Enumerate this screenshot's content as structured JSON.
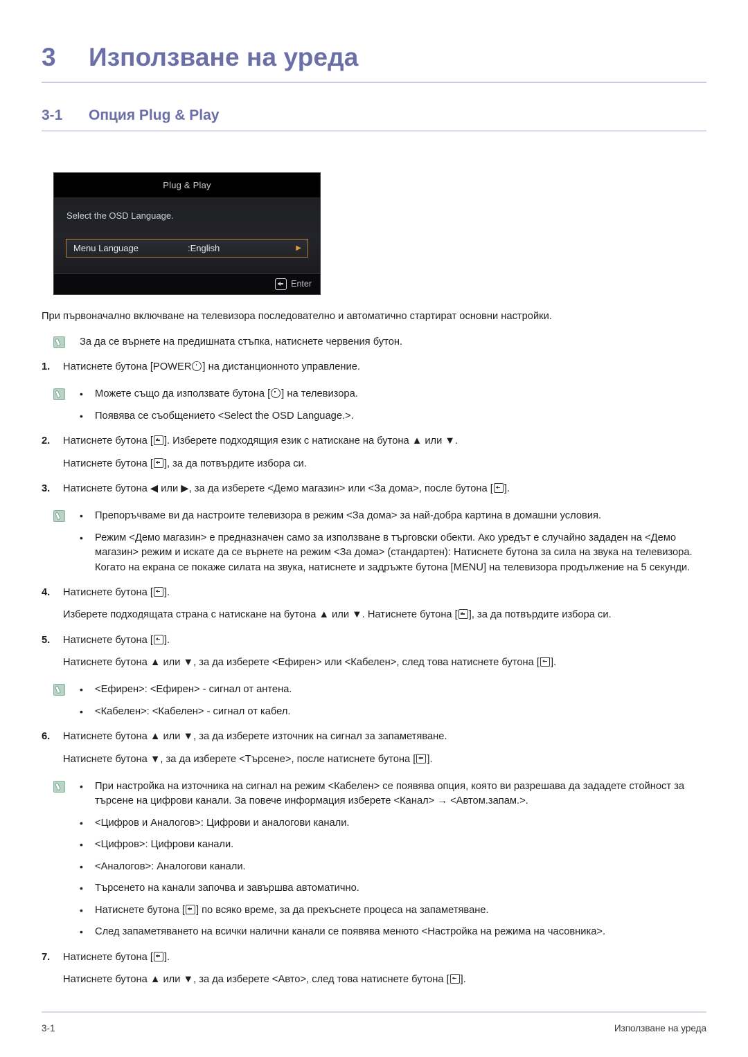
{
  "chapter": {
    "number": "3",
    "title": "Използване на уреда"
  },
  "section": {
    "number": "3-1",
    "title": "Опция Plug & Play"
  },
  "osd": {
    "title": "Plug & Play",
    "prompt": "Select the OSD Language.",
    "row_label": "Menu Language",
    "row_value": ":English",
    "row_arrow": "▶",
    "footer_label": "Enter"
  },
  "intro": "При първоначално включване на телевизора последователно и автоматично стартират основни настройки.",
  "note_intro": "За да се върнете на предишната стъпка, натиснете червения бутон.",
  "steps": [
    {
      "num": "1.",
      "lines": [
        {
          "pre": "Натиснете бутона [POWER",
          "glyph": "power",
          "post": "] на дистанционното управление."
        }
      ]
    },
    {
      "num": "2.",
      "lines": [
        {
          "pre": "Натиснете бутона [",
          "glyph": "enter",
          "post": "]. Изберете подходящия език с натискане на бутона ▲ или ▼."
        },
        {
          "pre": "Натиснете бутона [",
          "glyph": "enter",
          "post": "], за да потвърдите избора си."
        }
      ]
    },
    {
      "num": "3.",
      "lines": [
        {
          "pre": "Натиснете бутона ◀ или ▶, за да изберете <Демо магазин> или <За дома>, после бутона [",
          "glyph": "enter",
          "post": "]."
        }
      ]
    },
    {
      "num": "4.",
      "lines": [
        {
          "pre": "Натиснете бутона [",
          "glyph": "enter",
          "post": "]."
        },
        {
          "pre": "Изберете подходящата страна с натискане на бутона ▲ или ▼. Натиснете бутона [",
          "glyph": "enter",
          "post": "], за да потвърдите избора си."
        }
      ]
    },
    {
      "num": "5.",
      "lines": [
        {
          "pre": "Натиснете бутона [",
          "glyph": "enter",
          "post": "]."
        },
        {
          "pre": "Натиснете бутона ▲ или ▼, за да изберете <Ефирен> или <Кабелен>, след това натиснете бутона [",
          "glyph": "enter",
          "post": "]."
        }
      ]
    },
    {
      "num": "6.",
      "lines": [
        {
          "pre": "Натиснете бутона ▲ или ▼, за да изберете източник на сигнал за запаметяване.",
          "glyph": "",
          "post": ""
        },
        {
          "pre": "Натиснете бутона ▼, за да изберете <Търсене>, после натиснете бутона [",
          "glyph": "enter",
          "post": "]."
        }
      ]
    },
    {
      "num": "7.",
      "lines": [
        {
          "pre": "Натиснете бутона [",
          "glyph": "enter",
          "post": "]."
        },
        {
          "pre": "Натиснете бутона ▲ или ▼, за да изберете <Авто>, след това натиснете бутона [",
          "glyph": "enter",
          "post": "]."
        }
      ]
    }
  ],
  "note_power": {
    "bullets": [
      {
        "pre": "Можете също да използвате бутона [",
        "glyph": "power",
        "post": "] на телевизора."
      },
      {
        "pre": "Появява се съобщението <Select the OSD Language.>.",
        "glyph": "",
        "post": ""
      }
    ]
  },
  "note_mode": {
    "bullets": [
      {
        "pre": "Препоръчваме ви да настроите телевизора в режим <За дома> за най-добра картина в домашни условия.",
        "glyph": "",
        "post": ""
      },
      {
        "pre": "Режим <Демо магазин> е предназначен само за използване в търговски обекти. Ако уредът е случайно зададен на <Демо магазин> режим и искате да се върнете на режим <За дома> (стандартен): Натиснете бутона за сила на звука на телевизора. Когато на екрана се покаже силата на звука, натиснете и задръжте бутона [MENU] на телевизора продължение на 5 секунди.",
        "glyph": "",
        "post": ""
      }
    ]
  },
  "note_signal": {
    "bullets": [
      {
        "pre": "<Ефирен>: <Ефирен> - сигнал от антена.",
        "glyph": "",
        "post": ""
      },
      {
        "pre": "<Кабелен>: <Кабелен> - сигнал от кабел.",
        "glyph": "",
        "post": ""
      }
    ]
  },
  "note_channels": {
    "bullets": [
      {
        "pre": "При настройка на източника на сигнал на режим <Кабелен> се появява опция, която ви разрешава да зададете стойност за търсене на цифрови канали. За повече информация изберете <Канал> → <Автом.запам.>.",
        "glyph": "",
        "post": ""
      },
      {
        "pre": "<Цифров и Аналогов>: Цифрови и аналогови канали.",
        "glyph": "",
        "post": ""
      },
      {
        "pre": "<Цифров>: Цифрови канали.",
        "glyph": "",
        "post": ""
      },
      {
        "pre": "<Аналогов>: Аналогови канали.",
        "glyph": "",
        "post": ""
      },
      {
        "pre": "Търсенето на канали започва и завършва автоматично.",
        "glyph": "",
        "post": ""
      },
      {
        "pre": "Натиснете бутона [",
        "glyph": "enter",
        "post": "] по всяко време, за да прекъснете процеса на запаметяване."
      },
      {
        "pre": "След запаметяването на всички налични канали се появява менюто <Настройка на режима на часовника>.",
        "glyph": "",
        "post": ""
      }
    ]
  },
  "bullet_marker": "•",
  "footer": {
    "left": "3-1",
    "right": "Използване на уреда"
  },
  "colors": {
    "heading": "#6b6fa8",
    "rule": "#c9cbe4",
    "osd_highlight": "#b8873f",
    "note_icon": "#b9d4c6"
  }
}
